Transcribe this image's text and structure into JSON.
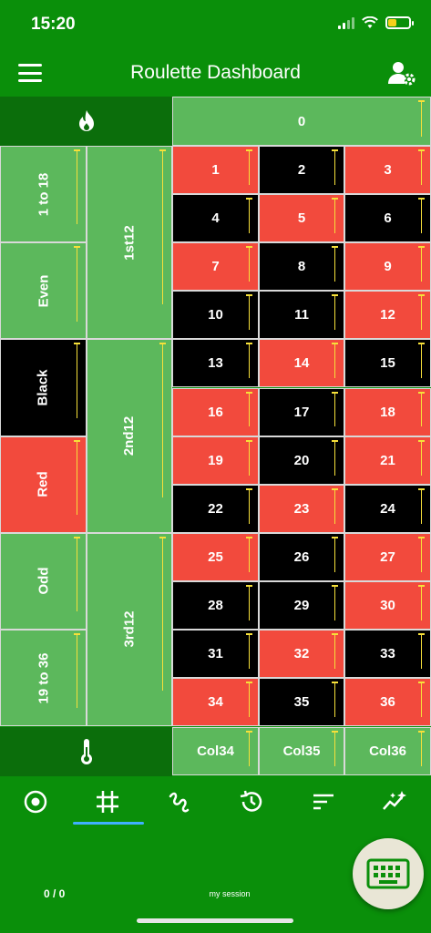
{
  "status": {
    "time": "15:20"
  },
  "app_bar": {
    "title": "Roulette Dashboard"
  },
  "board": {
    "zero": "0",
    "side_bets": [
      "1 to 18",
      "Even",
      "Black",
      "Red",
      "Odd",
      "19 to 36"
    ],
    "dozens": [
      "1st12",
      "2nd12",
      "3rd12"
    ],
    "numbers": [
      {
        "n": "1",
        "color": "red"
      },
      {
        "n": "2",
        "color": "black"
      },
      {
        "n": "3",
        "color": "red"
      },
      {
        "n": "4",
        "color": "black"
      },
      {
        "n": "5",
        "color": "red"
      },
      {
        "n": "6",
        "color": "black"
      },
      {
        "n": "7",
        "color": "red"
      },
      {
        "n": "8",
        "color": "black"
      },
      {
        "n": "9",
        "color": "red"
      },
      {
        "n": "10",
        "color": "black"
      },
      {
        "n": "11",
        "color": "black"
      },
      {
        "n": "12",
        "color": "red"
      },
      {
        "n": "13",
        "color": "black"
      },
      {
        "n": "14",
        "color": "red"
      },
      {
        "n": "15",
        "color": "black"
      },
      {
        "n": "16",
        "color": "red"
      },
      {
        "n": "17",
        "color": "black"
      },
      {
        "n": "18",
        "color": "red"
      },
      {
        "n": "19",
        "color": "red"
      },
      {
        "n": "20",
        "color": "black"
      },
      {
        "n": "21",
        "color": "red"
      },
      {
        "n": "22",
        "color": "black"
      },
      {
        "n": "23",
        "color": "red"
      },
      {
        "n": "24",
        "color": "black"
      },
      {
        "n": "25",
        "color": "red"
      },
      {
        "n": "26",
        "color": "black"
      },
      {
        "n": "27",
        "color": "red"
      },
      {
        "n": "28",
        "color": "black"
      },
      {
        "n": "29",
        "color": "black"
      },
      {
        "n": "30",
        "color": "red"
      },
      {
        "n": "31",
        "color": "black"
      },
      {
        "n": "32",
        "color": "red"
      },
      {
        "n": "33",
        "color": "black"
      },
      {
        "n": "34",
        "color": "red"
      },
      {
        "n": "35",
        "color": "black"
      },
      {
        "n": "36",
        "color": "red"
      }
    ],
    "columns": [
      "Col34",
      "Col35",
      "Col36"
    ],
    "hot_icon": "flame-icon",
    "cold_icon": "thermometer-icon"
  },
  "bottom_nav": {
    "items": [
      {
        "icon": "target-icon"
      },
      {
        "icon": "grid-icon"
      },
      {
        "icon": "squiggle-icon"
      },
      {
        "icon": "history-icon"
      },
      {
        "icon": "sort-icon"
      },
      {
        "icon": "sparkle-trend-icon"
      }
    ],
    "active_index": 1,
    "counter": "0 / 0",
    "session": "my session",
    "fab_icon": "keyboard-icon"
  },
  "colors": {
    "background": "#0a8f0a",
    "panel_green": "#5cb85c",
    "red": "#f24a3d",
    "black": "#000000",
    "marker": "#f6e03a",
    "active_tab": "#40b0ff"
  }
}
